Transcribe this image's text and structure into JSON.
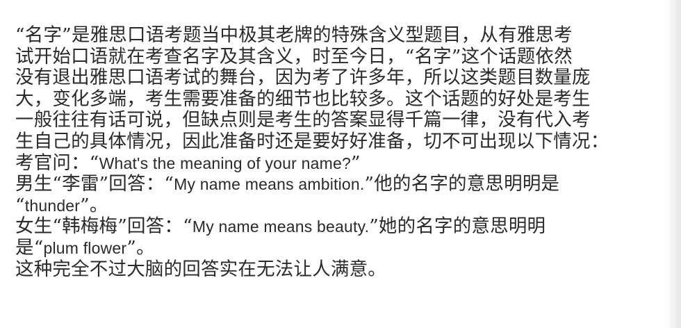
{
  "document": {
    "paragraph_lines": [
      "“名字”是雅思口语考题当中极其老牌的特殊含义型题目，从有雅思考",
      "试开始口语就在考查名字及其含义，时至今日，“名字”这个话题依然",
      "没有退出雅思口语考试的舞台，因为考了许多年，所以这类题目数量庞",
      "大，变化多端，考生需要准备的细节也比较多。这个话题的好处是考生",
      "一般往往有话可说，但缺点则是考生的答案显得千篇一律，没有代入考",
      "生自己的具体情况，因此准备时还是要好好准备，切不可出现以下情况："
    ],
    "examiner": {
      "prefix": "考官问：“",
      "question": "What's the meaning of your name?",
      "suffix": "”"
    },
    "male_answer": {
      "prefix": "男生“李雷”回答：“",
      "quote": "My name means ambition.",
      "after_quote": "”他的名字的意思明明是",
      "line2_prefix": "“",
      "line2_word": "thunder",
      "line2_suffix": "”。"
    },
    "female_answer": {
      "prefix": "女生“韩梅梅”回答：“",
      "quote": "My name means beauty.",
      "after_quote": "”她的名字的意思明明",
      "line2_prefix": "是“",
      "line2_word": "plum flower",
      "line2_suffix": "”。"
    },
    "conclusion": "这种完全不过大脑的回答实在无法让人满意。"
  }
}
